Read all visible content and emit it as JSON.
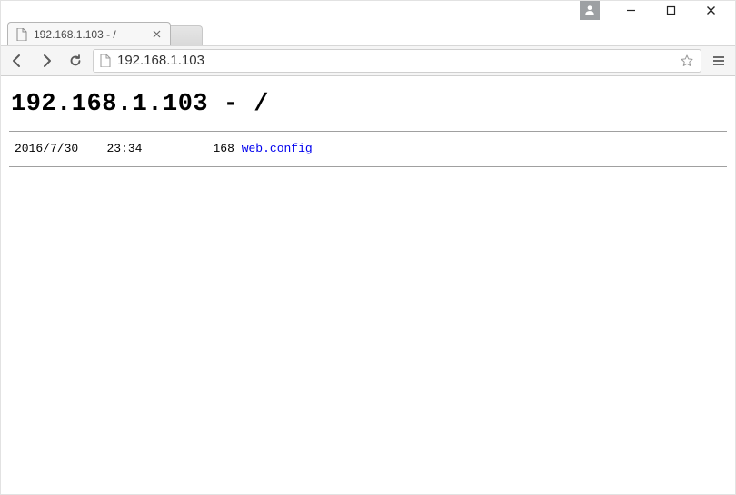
{
  "window": {
    "controls": {
      "minimize": "—",
      "maximize": "▢",
      "close": "✕"
    }
  },
  "browser": {
    "tab": {
      "title": "192.168.1.103 - /"
    },
    "url": "192.168.1.103"
  },
  "page": {
    "heading": "192.168.1.103 - /",
    "listing": {
      "date": "2016/7/30",
      "time": "23:34",
      "size": "168",
      "filename": "web.config"
    }
  }
}
